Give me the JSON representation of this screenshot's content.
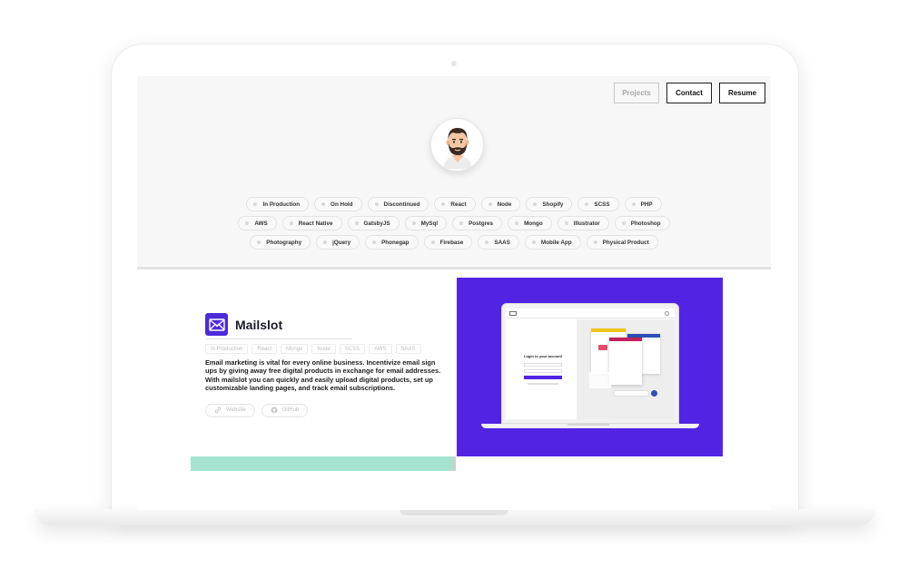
{
  "nav": {
    "items": [
      {
        "label": "Projects",
        "active": true
      },
      {
        "label": "Contact",
        "active": false
      },
      {
        "label": "Resume",
        "active": false
      }
    ]
  },
  "tags": {
    "rows": [
      [
        "In Production",
        "On Hold",
        "Discontinued",
        "React",
        "Node",
        "Shopify",
        "SCSS",
        "PHP"
      ],
      [
        "AWS",
        "React Native",
        "GatsbyJS",
        "MySql",
        "Postgres",
        "Mongo",
        "Illustrator",
        "Photoshop"
      ],
      [
        "Photography",
        "jQuery",
        "Phonegap",
        "Firebase",
        "SAAS",
        "Mobile App",
        "Physical Product"
      ]
    ]
  },
  "project": {
    "title": "Mailslot",
    "tags": [
      "In Production",
      "React",
      "Mongo",
      "Node",
      "SCSS",
      "AWS",
      "SAAS"
    ],
    "description": "Email marketing is vital for every online business. Incentivize email sign ups by giving away free digital products in exchange for email addresses. With mailslot you can quickly and easily upload digital products, set up customizable landing pages, and track email subscriptions.",
    "links": {
      "website": "Website",
      "github": "GitHub"
    },
    "mockup": {
      "login_title": "Login to your account"
    }
  },
  "colors": {
    "showcase_bg": "#5124e4",
    "logo_bg": "#4c2bd9",
    "accent_bar": "#a6e3d1"
  },
  "icons": {
    "avatar": "bearded-man-avatar",
    "project_logo": "envelope-icon",
    "website": "link-icon",
    "github": "github-icon"
  }
}
